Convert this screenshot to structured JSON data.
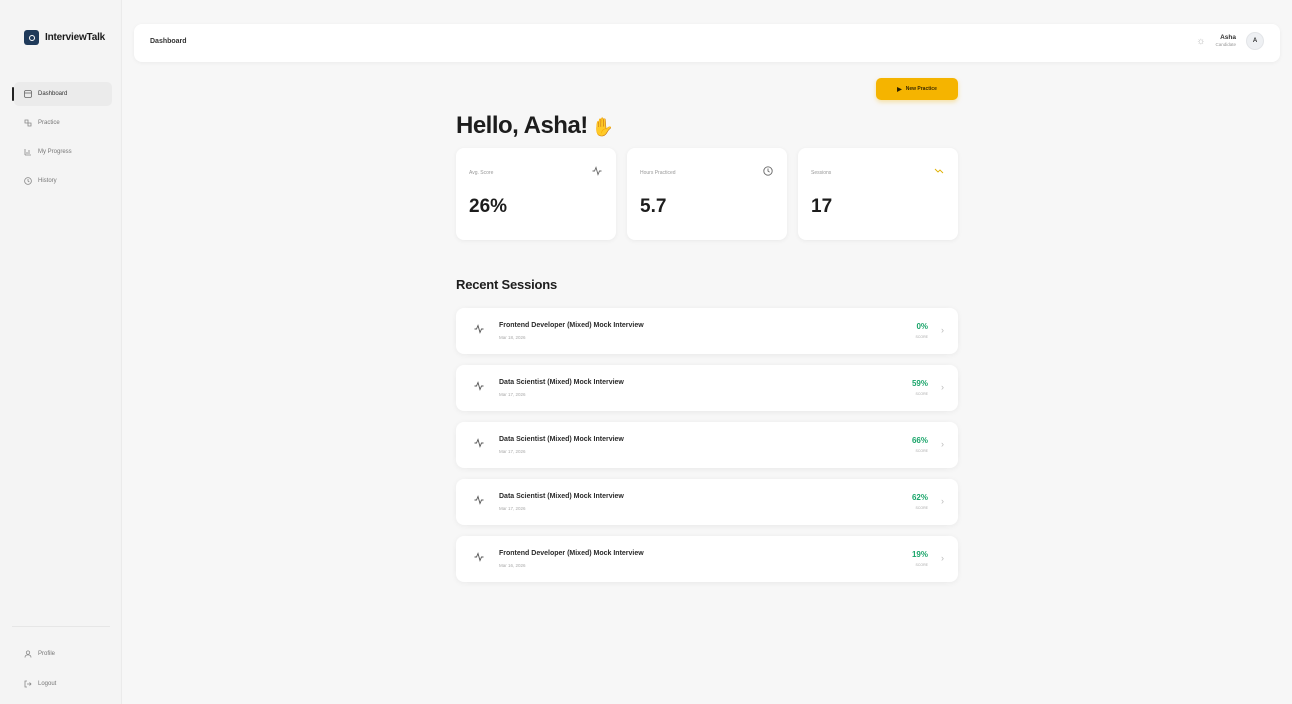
{
  "app": {
    "name": "InterviewTalk"
  },
  "sidebar": {
    "items": [
      {
        "label": "Dashboard",
        "icon": "dashboard-icon"
      },
      {
        "label": "Practice",
        "icon": "practice-icon"
      },
      {
        "label": "My Progress",
        "icon": "chart-icon"
      },
      {
        "label": "History",
        "icon": "clock-icon"
      }
    ],
    "bottom": [
      {
        "label": "Profile",
        "icon": "user-icon"
      },
      {
        "label": "Logout",
        "icon": "logout-icon"
      }
    ]
  },
  "header": {
    "breadcrumb": "Dashboard",
    "user_name": "Asha",
    "user_role": "Candidate",
    "avatar_initial": "A"
  },
  "main": {
    "greeting": "Hello, Asha!",
    "new_practice_label": "New Practice",
    "stats": [
      {
        "label": "Avg. Score",
        "value": "26%",
        "icon": "activity-icon"
      },
      {
        "label": "Hours Practiced",
        "value": "5.7",
        "icon": "clock-icon"
      },
      {
        "label": "Sessions",
        "value": "17",
        "icon": "trend-icon"
      }
    ],
    "recent_title": "Recent Sessions",
    "sessions": [
      {
        "title": "Frontend Developer (Mixed) Mock Interview",
        "date": "Mar 18, 2026",
        "score": "0%",
        "score_label": "SCORE",
        "color": "#1aa56a"
      },
      {
        "title": "Data Scientist (Mixed) Mock Interview",
        "date": "Mar 17, 2026",
        "score": "59%",
        "score_label": "SCORE",
        "color": "#1aa56a"
      },
      {
        "title": "Data Scientist (Mixed) Mock Interview",
        "date": "Mar 17, 2026",
        "score": "66%",
        "score_label": "SCORE",
        "color": "#1aa56a"
      },
      {
        "title": "Data Scientist (Mixed) Mock Interview",
        "date": "Mar 17, 2026",
        "score": "62%",
        "score_label": "SCORE",
        "color": "#1aa56a"
      },
      {
        "title": "Frontend Developer (Mixed) Mock Interview",
        "date": "Mar 16, 2026",
        "score": "19%",
        "score_label": "SCORE",
        "color": "#1aa56a"
      }
    ]
  },
  "colors": {
    "accent": "#f5b400",
    "score_green": "#1aa56a",
    "brand_dark": "#1f3a5a"
  }
}
